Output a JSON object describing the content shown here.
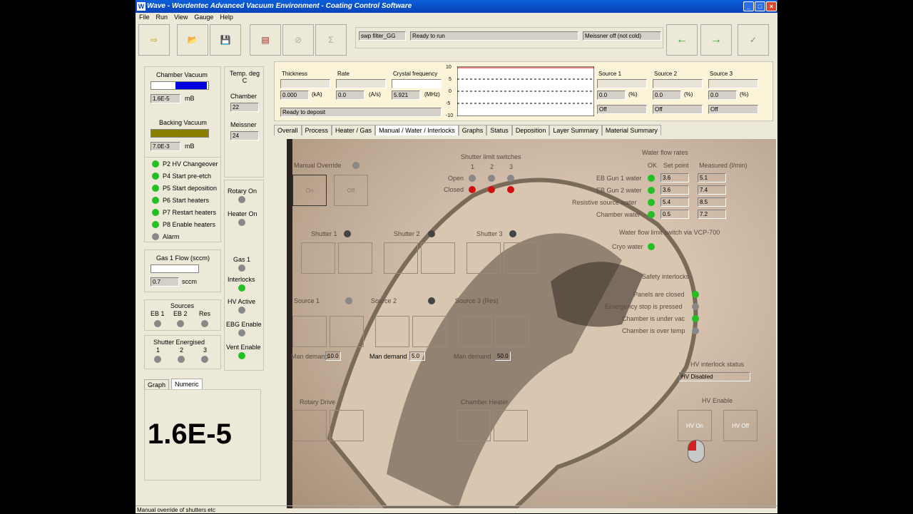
{
  "app": {
    "title": "Wave - Wordentec Advanced Vacuum Environment - Coating Control Software"
  },
  "menu": [
    "File",
    "Run",
    "View",
    "Gauge",
    "Help"
  ],
  "toolbar": {
    "recipe": "swp filter_GG",
    "status": "Ready to run",
    "meissner": "Meissner off (not cold)"
  },
  "left": {
    "chamber_vacuum_label": "Chamber Vacuum",
    "chamber_vacuum_value": "1.6E-5",
    "unit_mb": "mB",
    "backing_vacuum_label": "Backing Vacuum",
    "backing_vacuum_value": "7.0E-3",
    "temp_label": "Temp. deg C",
    "chamber_label": "Chamber",
    "chamber_temp": "22",
    "meissner_label": "Meissner",
    "meissner_temp": "24",
    "interlocks": [
      "P2 HV Changeover",
      "P4 Start pre-etch",
      "P5 Start deposition",
      "P6 Start heaters",
      "P7 Restart heaters",
      "P8 Enable heaters",
      "Alarm"
    ],
    "rotary_on": "Rotary On",
    "heater_on": "Heater On",
    "gas_flow_label": "Gas 1 Flow (sccm)",
    "gas_flow_value": "0.7",
    "sccm": "sccm",
    "gas1": "Gas 1",
    "interlocks_label": "Interlocks",
    "hv_active": "HV Active",
    "ebg_enable": "EBG Enable",
    "vent_enable": "Vent Enable",
    "sources_label": "Sources",
    "eb1": "EB 1",
    "eb2": "EB 2",
    "res": "Res",
    "shutter_energised": "Shutter Energised",
    "s1": "1",
    "s2": "2",
    "s3": "3",
    "tab_graph": "Graph",
    "tab_numeric": "Numeric",
    "big_value": "1.6E-5"
  },
  "deposition": {
    "thickness_label": "Thickness",
    "thickness": "0.000",
    "thickness_unit": "(kA)",
    "rate_label": "Rate",
    "rate": "0.0",
    "rate_unit": "(A/s)",
    "crystal_label": "Crystal frequency",
    "crystal": "5.921",
    "crystal_unit": "(MHz)",
    "status": "Ready to deposit",
    "axis": [
      "10",
      "5",
      "0",
      "-5",
      "-10"
    ],
    "sources": [
      {
        "label": "Source 1",
        "value": "0.0",
        "unit": "(%)",
        "state": "Off"
      },
      {
        "label": "Source 2",
        "value": "0.0",
        "unit": "(%)",
        "state": "Off"
      },
      {
        "label": "Source 3",
        "value": "0.0",
        "unit": "(%)",
        "state": "Off"
      }
    ]
  },
  "tabs": [
    "Overall",
    "Process",
    "Heater / Gas",
    "Manual / Water / Interlocks",
    "Graphs",
    "Status",
    "Deposition",
    "Layer Summary",
    "Material Summary"
  ],
  "manual": {
    "manual_override": "Manual Override",
    "on": "On",
    "off": "Off",
    "shutter_limit": "Shutter limit switches",
    "open": "Open",
    "closed": "Closed",
    "shutter1": "Shutter 1",
    "shutter2": "Shutter 2",
    "shutter3": "Shutter 3",
    "source1": "Source 1",
    "source2": "Source 2",
    "source3": "Source 3 (Res)",
    "man_demand": "Man demand",
    "demand1": "10.0",
    "demand2": "5.0",
    "demand3": "50.0",
    "rotary_drive": "Rotary Drive",
    "chamber_heater": "Chamber Heater",
    "water_flow_rates": "Water flow rates",
    "ok": "OK",
    "set_point": "Set point",
    "measured": "Measured (l/min)",
    "water": [
      {
        "name": "EB Gun 1 water",
        "set": "3.6",
        "measured": "5.1"
      },
      {
        "name": "EB Gun 2 water",
        "set": "3.6",
        "measured": "7.4"
      },
      {
        "name": "Resistive source water",
        "set": "5.4",
        "measured": "8.5"
      },
      {
        "name": "Chamber water",
        "set": "0.5",
        "measured": "7.2"
      }
    ],
    "water_limit": "Water flow limit switch via VCP-700",
    "cryo": "Cryo water",
    "safety": "Safety interlocks",
    "safety_items": [
      "Panels are closed",
      "Emergency stop is pressed",
      "Chamber is under vac",
      "Chamber is over temp"
    ],
    "hv_status_label": "HV interlock status",
    "hv_status": "HV Disabled",
    "hv_enable": "HV Enable",
    "hv_on": "HV On",
    "hv_off": "HV Off"
  },
  "status_bar": "Manual override of shutters etc"
}
